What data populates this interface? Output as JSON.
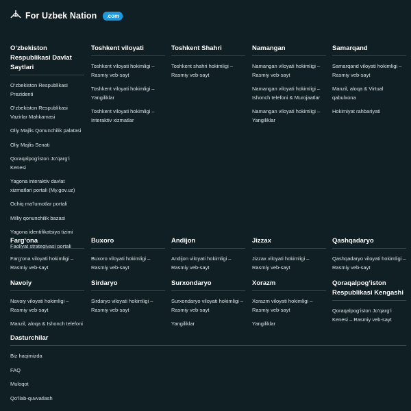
{
  "brand": {
    "name": "For Uzbek Nation",
    "badge": ".com"
  },
  "sections": [
    {
      "title": "O‘zbekiston Respublikasi Davlat Saytlari",
      "links": [
        "O‘zbekiston Respublikasi Prezidenti",
        "O‘zbekiston Respublikasi Vazirlar Mahkamasi",
        "Oliy Majlis Qonunchilik palatasi",
        "Oliy Majlis Senati",
        "Qoraqalpog‘iston Jo‘qarg‘i Kenesi",
        "Yagona interaktiv davlat xizmatlari portali (My.gov.uz)",
        "Ochiq ma’lumotlar portali",
        "Milliy qonunchilik bazasi",
        "Yagona identifikatsiya tizimi",
        "Faoliyat strategiyasi portali"
      ]
    },
    {
      "title": "Toshkent viloyati",
      "links": [
        "Toshkent viloyati hokimligi – Rasmiy veb-sayt",
        "Toshkent viloyati hokimligi – Yangiliklar",
        "Toshkent viloyati hokimligi – Interaktiv xizmatlar"
      ]
    },
    {
      "title": "Toshkent Shahri",
      "links": [
        "Toshkent shahri hokimligi – Rasmiy veb-sayt"
      ]
    },
    {
      "title": "Namangan",
      "links": [
        "Namangan viloyati hokimligi – Rasmiy veb-sayt",
        "Namangan viloyati hokimligi – Ishonch telefoni & Murojaatlar",
        "Namangan viloyati hokimligi – Yangiliklar"
      ]
    },
    {
      "title": "Samarqand",
      "links": [
        "Samarqand viloyati hokimligi – Rasmiy veb-sayt",
        "Manzil, aloqa & Virtual qabulxona",
        "Hokimiyat rahbariyati"
      ]
    },
    {
      "title": "Farg‘ona",
      "links": [
        "Farg‘ona viloyati hokimligi – Rasmiy veb-sayt"
      ]
    },
    {
      "title": "Buxoro",
      "links": [
        "Buxoro viloyati hokimligi – Rasmiy veb-sayt"
      ]
    },
    {
      "title": "Andijon",
      "links": [
        "Andijon viloyati hokimligi – Rasmiy veb-sayt"
      ]
    },
    {
      "title": "Jizzax",
      "links": [
        "Jizzax viloyati hokimligi – Rasmiy veb-sayt"
      ]
    },
    {
      "title": "Qashqadaryo",
      "links": [
        "Qashqadaryo viloyati hokimligi – Rasmiy veb-sayt"
      ]
    },
    {
      "title": "Navoiy",
      "links": [
        "Navoiy viloyati hokimligi – Rasmiy veb-sayt",
        "Manzil, aloqa & Ishonch telefoni"
      ]
    },
    {
      "title": "Sirdaryo",
      "links": [
        "Sirdaryo viloyati hokimligi – Rasmiy veb-sayt"
      ]
    },
    {
      "title": "Surxondaryo",
      "links": [
        "Surxondaryo viloyati hokimligi – Rasmiy veb-sayt",
        "Yangiliklar"
      ]
    },
    {
      "title": "Xorazm",
      "links": [
        "Xorazm viloyati hokimligi – Rasmiy veb-sayt",
        "Yangiliklar"
      ]
    },
    {
      "title": "Qoraqalpog‘iston Respublikasi Kengashi",
      "links": [
        "Qoraqalpog‘iston Jo‘qarg‘i Kenesi – Rasmiy veb-sayt"
      ]
    },
    {
      "title": "Dasturchilar",
      "links": [
        "Biz haqimizda",
        "FAQ",
        "Muloqot",
        "Qo‘llab-quvvatlash"
      ]
    }
  ]
}
